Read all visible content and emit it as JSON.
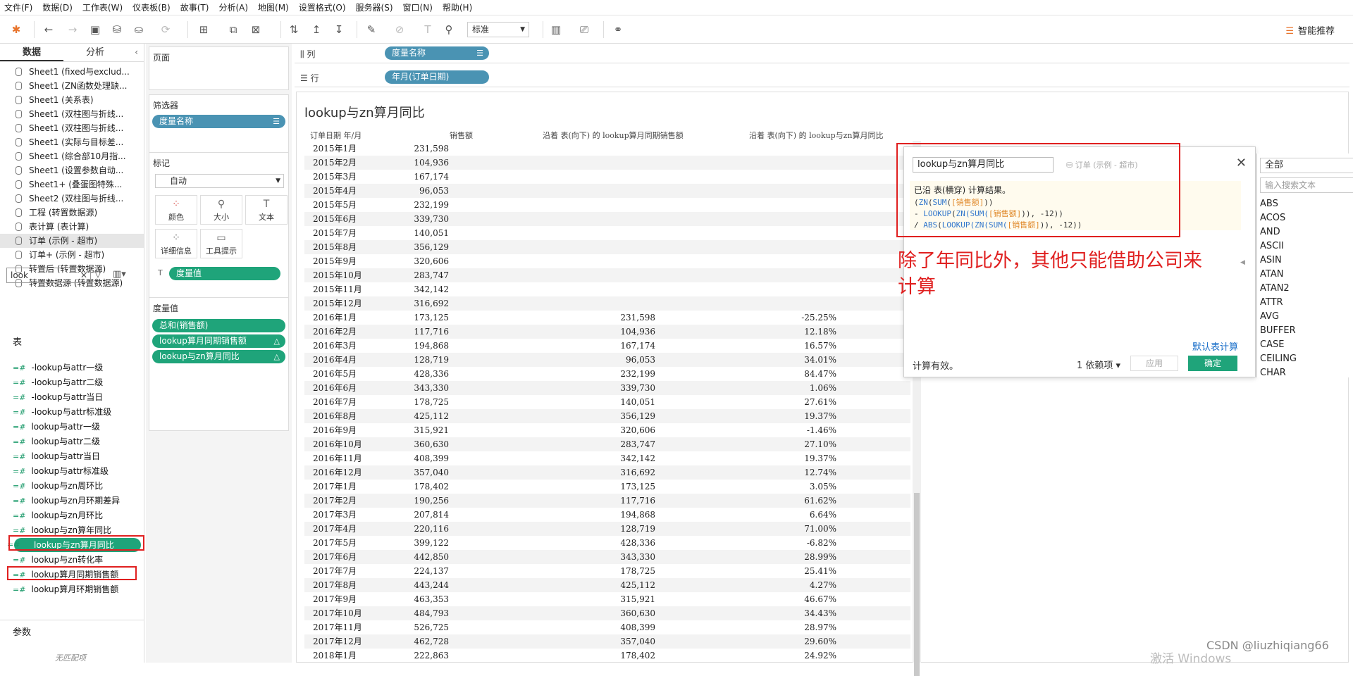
{
  "menu": [
    "文件(F)",
    "数据(D)",
    "工作表(W)",
    "仪表板(B)",
    "故事(T)",
    "分析(A)",
    "地图(M)",
    "设置格式(O)",
    "服务器(S)",
    "窗口(N)",
    "帮助(H)"
  ],
  "toolbar": {
    "standard_select": "标准",
    "smart_recommend": "智能推荐"
  },
  "left_panel": {
    "tab_data": "数据",
    "tab_analysis": "分析",
    "datasources": [
      "Sheet1 (fixed与exclud...",
      "Sheet1 (ZN函数处理缺...",
      "Sheet1 (关系表)",
      "Sheet1 (双柱图与折线...",
      "Sheet1 (双柱图与折线...",
      "Sheet1 (实际与目标差...",
      "Sheet1 (综合部10月指...",
      "Sheet1 (设置参数自动...",
      "Sheet1+ (叠蛋图特殊...",
      "Sheet2 (双柱图与折线...",
      "工程 (转置数据源)",
      "表计算 (表计算)",
      "订单 (示例 - 超市)",
      "订单+ (示例 - 超市)",
      "转置后 (转置数据源)",
      "转置数据源 (转置数据源)"
    ],
    "search_value": "look",
    "table_heading": "表",
    "fields": [
      "-lookup与attr一级",
      "-lookup与attr二级",
      "-lookup与attr当日",
      "-lookup与attr标准级",
      "lookup与attr一级",
      "lookup与attr二级",
      "lookup与attr当日",
      "lookup与attr标准级",
      "lookup与zn周环比",
      "lookup与zn月环期差异",
      "lookup与zn月环比",
      "lookup与zn算年同比",
      "lookup与zn算月同比",
      "lookup与zn转化率",
      "lookup算月同期销售额",
      "lookup算月环期销售额"
    ],
    "params_heading": "参数",
    "params_empty": "无匹配项"
  },
  "shelves": {
    "pages": "页面",
    "filters": "筛选器",
    "filter_pill": "度量名称",
    "marks": "标记",
    "mark_type": "自动",
    "mark_buttons": [
      "颜色",
      "大小",
      "文本",
      "详细信息",
      "工具提示"
    ],
    "mark_pill": "度量值",
    "measure_values": "度量值",
    "measure_pills": [
      "总和(销售额)",
      "lookup算月同期销售额",
      "lookup与zn算月同比"
    ],
    "columns_label": "列",
    "columns_pill": "度量名称",
    "rows_label": "行",
    "rows_pill": "年月(订单日期)"
  },
  "sheet": {
    "title": "lookup与zn算月同比",
    "headers": [
      "订单日期 年/月",
      "销售额",
      "沿着 表(向下) 的 lookup算月同期销售额",
      "沿着 表(向下) 的 lookup与zn算月同比"
    ],
    "rows": [
      [
        "2015年1月",
        "231,598",
        "",
        ""
      ],
      [
        "2015年2月",
        "104,936",
        "",
        ""
      ],
      [
        "2015年3月",
        "167,174",
        "",
        ""
      ],
      [
        "2015年4月",
        "96,053",
        "",
        ""
      ],
      [
        "2015年5月",
        "232,199",
        "",
        ""
      ],
      [
        "2015年6月",
        "339,730",
        "",
        ""
      ],
      [
        "2015年7月",
        "140,051",
        "",
        ""
      ],
      [
        "2015年8月",
        "356,129",
        "",
        ""
      ],
      [
        "2015年9月",
        "320,606",
        "",
        ""
      ],
      [
        "2015年10月",
        "283,747",
        "",
        ""
      ],
      [
        "2015年11月",
        "342,142",
        "",
        ""
      ],
      [
        "2015年12月",
        "316,692",
        "",
        ""
      ],
      [
        "2016年1月",
        "173,125",
        "231,598",
        "-25.25%"
      ],
      [
        "2016年2月",
        "117,716",
        "104,936",
        "12.18%"
      ],
      [
        "2016年3月",
        "194,868",
        "167,174",
        "16.57%"
      ],
      [
        "2016年4月",
        "128,719",
        "96,053",
        "34.01%"
      ],
      [
        "2016年5月",
        "428,336",
        "232,199",
        "84.47%"
      ],
      [
        "2016年6月",
        "343,330",
        "339,730",
        "1.06%"
      ],
      [
        "2016年7月",
        "178,725",
        "140,051",
        "27.61%"
      ],
      [
        "2016年8月",
        "425,112",
        "356,129",
        "19.37%"
      ],
      [
        "2016年9月",
        "315,921",
        "320,606",
        "-1.46%"
      ],
      [
        "2016年10月",
        "360,630",
        "283,747",
        "27.10%"
      ],
      [
        "2016年11月",
        "408,399",
        "342,142",
        "19.37%"
      ],
      [
        "2016年12月",
        "357,040",
        "316,692",
        "12.74%"
      ],
      [
        "2017年1月",
        "178,402",
        "173,125",
        "3.05%"
      ],
      [
        "2017年2月",
        "190,256",
        "117,716",
        "61.62%"
      ],
      [
        "2017年3月",
        "207,814",
        "194,868",
        "6.64%"
      ],
      [
        "2017年4月",
        "220,116",
        "128,719",
        "71.00%"
      ],
      [
        "2017年5月",
        "399,122",
        "428,336",
        "-6.82%"
      ],
      [
        "2017年6月",
        "442,850",
        "343,330",
        "28.99%"
      ],
      [
        "2017年7月",
        "224,137",
        "178,725",
        "25.41%"
      ],
      [
        "2017年8月",
        "443,244",
        "425,112",
        "4.27%"
      ],
      [
        "2017年9月",
        "463,353",
        "315,921",
        "46.67%"
      ],
      [
        "2017年10月",
        "484,793",
        "360,630",
        "34.43%"
      ],
      [
        "2017年11月",
        "526,725",
        "408,399",
        "28.97%"
      ],
      [
        "2017年12月",
        "462,728",
        "357,040",
        "29.60%"
      ],
      [
        "2018年1月",
        "222,863",
        "178,402",
        "24.92%"
      ]
    ]
  },
  "calc_dialog": {
    "name": "lookup与zn算月同比",
    "source": "订单 (示例 - 超市)",
    "note": "已沿 表(横穿) 计算结果。",
    "formula_lines": [
      {
        "pre": "(",
        "kw1": "ZN",
        "mid": "(",
        "kw2": "SUM",
        "mid2": "(",
        "field": "[销售额]",
        "post": "))"
      },
      {
        "pre": "- ",
        "kw1": "LOOKUP",
        "mid": "(",
        "kw2": "ZN(SUM(",
        "mid2": "",
        "field": "[销售额]",
        "post": ")), -12))"
      },
      {
        "pre": "/ ",
        "kw1": "ABS",
        "mid": "(",
        "kw2": "LOOKUP(ZN(SUM(",
        "mid2": "",
        "field": "[销售额]",
        "post": ")), -12))"
      }
    ],
    "default_table_calc": "默认表计算",
    "status": "计算有效。",
    "dependencies": "1 依赖项",
    "apply": "应用",
    "ok": "确定"
  },
  "annotation": "除了年同比外，其他只能借助公司来计算",
  "functions": {
    "category": "全部",
    "search_placeholder": "输入搜索文本",
    "list": [
      "ABS",
      "ACOS",
      "AND",
      "ASCII",
      "ASIN",
      "ATAN",
      "ATAN2",
      "ATTR",
      "AVG",
      "BUFFER",
      "CASE",
      "CEILING",
      "CHAR"
    ]
  },
  "watermark": {
    "activate": "激活 Windows",
    "csdn": "CSDN @liuzhiqiang66"
  }
}
